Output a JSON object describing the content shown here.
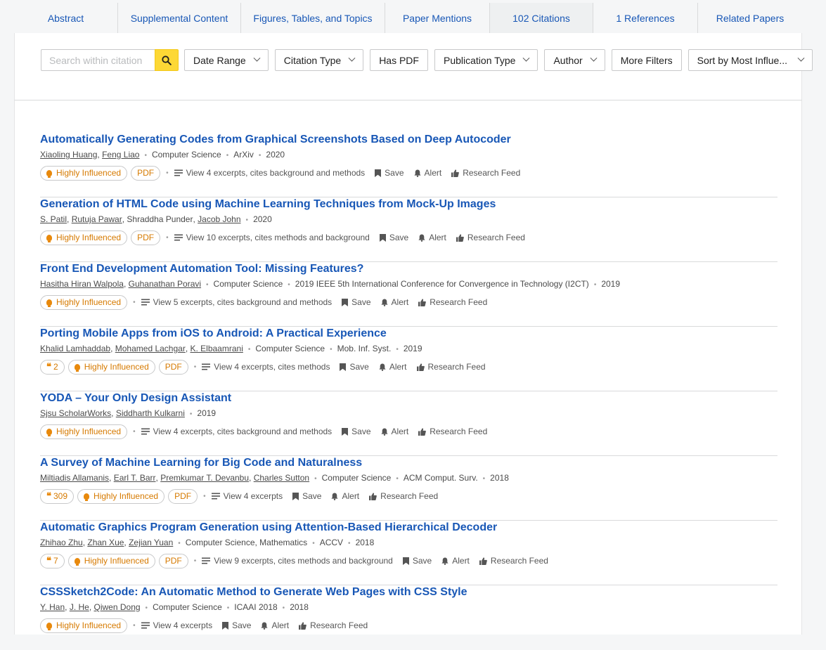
{
  "tabs": [
    {
      "label": "Abstract",
      "active": false
    },
    {
      "label": "Supplemental Content",
      "active": false
    },
    {
      "label": "Figures, Tables, and Topics",
      "active": false
    },
    {
      "label": "Paper Mentions",
      "active": false
    },
    {
      "label": "102 Citations",
      "active": true
    },
    {
      "label": "1 References",
      "active": false
    },
    {
      "label": "Related Papers",
      "active": false
    }
  ],
  "filters": {
    "search_placeholder": "Search within citation",
    "date_range": "Date Range",
    "citation_type": "Citation Type",
    "has_pdf": "Has PDF",
    "publication_type": "Publication Type",
    "author": "Author",
    "more_filters": "More Filters",
    "sort": "Sort by Most Influe..."
  },
  "action_labels": {
    "save": "Save",
    "alert": "Alert",
    "research_feed": "Research Feed",
    "highly_influenced": "Highly Influenced",
    "pdf": "PDF"
  },
  "results": [
    {
      "title": "Automatically Generating Codes from Graphical Screenshots Based on Deep Autocoder",
      "authors": [
        {
          "name": "Xiaoling Huang",
          "linked": true
        },
        {
          "name": "Feng Liao",
          "linked": true
        }
      ],
      "meta": [
        "Computer Science",
        "ArXiv",
        "2020"
      ],
      "citations": null,
      "highly_influenced": true,
      "pdf": true,
      "excerpts": "View 4 excerpts, cites background and methods"
    },
    {
      "title": "Generation of HTML Code using Machine Learning Techniques from Mock-Up Images",
      "authors": [
        {
          "name": "S. Patil",
          "linked": true
        },
        {
          "name": "Rutuja Pawar",
          "linked": true
        },
        {
          "name": "Shraddha Punder",
          "linked": false
        },
        {
          "name": "Jacob John",
          "linked": true
        }
      ],
      "meta": [
        "2020"
      ],
      "citations": null,
      "highly_influenced": true,
      "pdf": true,
      "excerpts": "View 10 excerpts, cites methods and background"
    },
    {
      "title": "Front End Development Automation Tool: Missing Features?",
      "authors": [
        {
          "name": "Hasitha Hiran Walpola",
          "linked": true
        },
        {
          "name": "Guhanathan Poravi",
          "linked": true
        }
      ],
      "meta": [
        "Computer Science",
        "2019 IEEE 5th International Conference for Convergence in Technology (I2CT)",
        "2019"
      ],
      "citations": null,
      "highly_influenced": true,
      "pdf": false,
      "excerpts": "View 5 excerpts, cites background and methods"
    },
    {
      "title": "Porting Mobile Apps from iOS to Android: A Practical Experience",
      "authors": [
        {
          "name": "Khalid Lamhaddab",
          "linked": true
        },
        {
          "name": "Mohamed Lachgar",
          "linked": true
        },
        {
          "name": "K. Elbaamrani",
          "linked": true
        }
      ],
      "meta": [
        "Computer Science",
        "Mob. Inf. Syst.",
        "2019"
      ],
      "citations": "2",
      "highly_influenced": true,
      "pdf": true,
      "excerpts": "View 4 excerpts, cites methods"
    },
    {
      "title": "YODA – Your Only Design Assistant",
      "authors": [
        {
          "name": "Sjsu ScholarWorks",
          "linked": true
        },
        {
          "name": "Siddharth Kulkarni",
          "linked": true
        }
      ],
      "meta": [
        "2019"
      ],
      "citations": null,
      "highly_influenced": true,
      "pdf": false,
      "excerpts": "View 4 excerpts, cites background and methods"
    },
    {
      "title": "A Survey of Machine Learning for Big Code and Naturalness",
      "authors": [
        {
          "name": "Miltiadis Allamanis",
          "linked": true
        },
        {
          "name": "Earl T. Barr",
          "linked": true
        },
        {
          "name": "Premkumar T. Devanbu",
          "linked": true
        },
        {
          "name": "Charles Sutton",
          "linked": true
        }
      ],
      "meta": [
        "Computer Science",
        "ACM Comput. Surv.",
        "2018"
      ],
      "citations": "309",
      "highly_influenced": true,
      "pdf": true,
      "excerpts": "View 4 excerpts"
    },
    {
      "title": "Automatic Graphics Program Generation using Attention-Based Hierarchical Decoder",
      "authors": [
        {
          "name": "Zhihao Zhu",
          "linked": true
        },
        {
          "name": "Zhan Xue",
          "linked": true
        },
        {
          "name": "Zejian Yuan",
          "linked": true
        }
      ],
      "meta": [
        "Computer Science, Mathematics",
        "ACCV",
        "2018"
      ],
      "citations": "7",
      "highly_influenced": true,
      "pdf": true,
      "excerpts": "View 9 excerpts, cites methods and background"
    },
    {
      "title": "CSSSketch2Code: An Automatic Method to Generate Web Pages with CSS Style",
      "authors": [
        {
          "name": "Y. Han",
          "linked": true
        },
        {
          "name": "J. He",
          "linked": true
        },
        {
          "name": "Qiwen Dong",
          "linked": true
        }
      ],
      "meta": [
        "Computer Science",
        "ICAAI 2018",
        "2018"
      ],
      "citations": null,
      "highly_influenced": true,
      "pdf": false,
      "excerpts": "View 4 excerpts"
    }
  ]
}
